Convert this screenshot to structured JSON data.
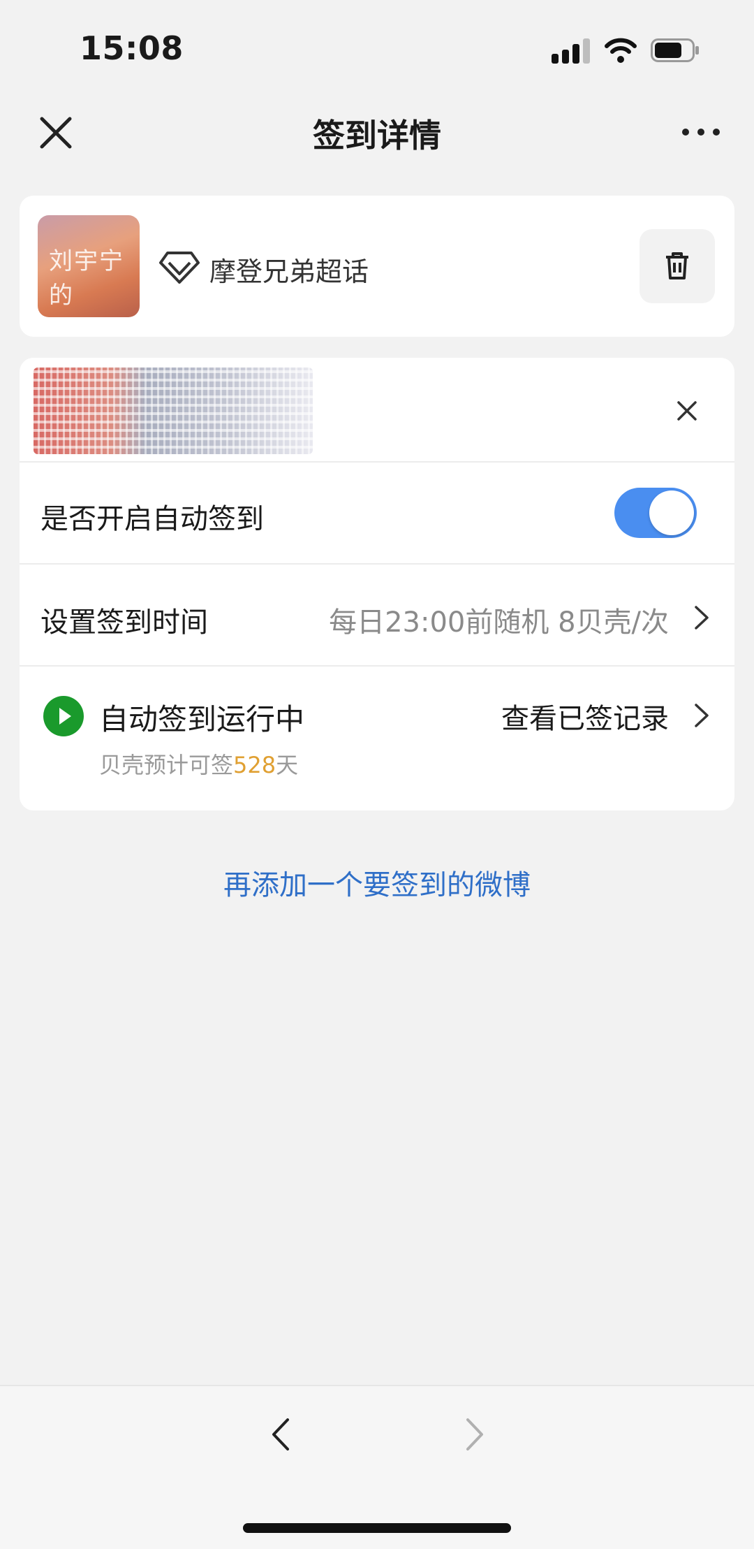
{
  "status_bar": {
    "time": "15:08"
  },
  "nav": {
    "title": "签到详情"
  },
  "topic_card": {
    "cover_text": "刘宇宁的",
    "topic_name": "摩登兄弟超话"
  },
  "settings": {
    "auto_signin_label": "是否开启自动签到",
    "auto_signin_enabled": true,
    "time_label": "设置签到时间",
    "time_value": "每日23:00前随机 8贝壳/次",
    "running_label": "自动签到运行中",
    "history_link": "查看已签记录",
    "estimate_prefix": "贝壳预计可签",
    "estimate_days": "528",
    "estimate_suffix": "天"
  },
  "add_link": "再添加一个要签到的微博",
  "colors": {
    "accent_blue": "#4a8ef0",
    "link_blue": "#2f6fc8",
    "running_green": "#1a9a2c",
    "highlight_orange": "#e0a032"
  }
}
